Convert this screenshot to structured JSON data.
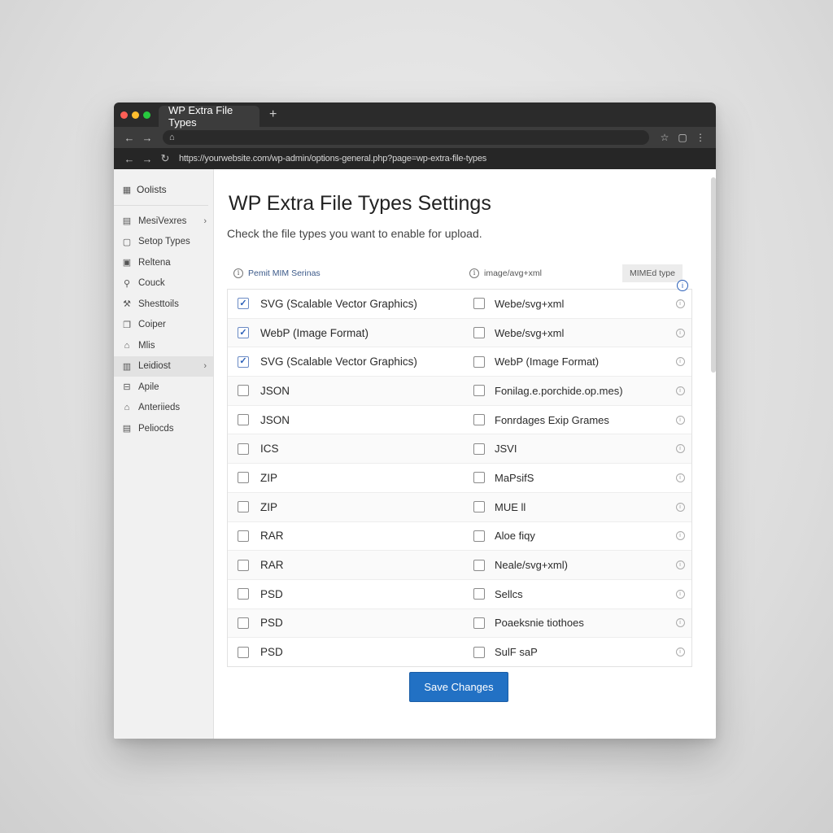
{
  "browser": {
    "tab_title": "WP Extra File Types",
    "new_tab_glyph": "+",
    "home_glyph": "⌂",
    "address": "https://yourwebsite.com/wp-admin/options-general.php?page=wp-extra-file-types"
  },
  "sidebar": {
    "header": "Oolists",
    "items": [
      {
        "label": "MesiVexres",
        "icon": "media-icon",
        "chevron": true,
        "active": false
      },
      {
        "label": "Setop Types",
        "icon": "page-icon",
        "chevron": false,
        "active": false
      },
      {
        "label": "Reltena",
        "icon": "grid-icon",
        "chevron": false,
        "active": false
      },
      {
        "label": "Couck",
        "icon": "plugin-icon",
        "chevron": false,
        "active": false
      },
      {
        "label": "Shesttoils",
        "icon": "tools-icon",
        "chevron": false,
        "active": false
      },
      {
        "label": "Coiper",
        "icon": "copy-icon",
        "chevron": false,
        "active": false
      },
      {
        "label": "Mlis",
        "icon": "house-icon",
        "chevron": false,
        "active": false
      },
      {
        "label": "Leidiost",
        "icon": "settings-icon",
        "chevron": true,
        "active": true
      },
      {
        "label": "Apile",
        "icon": "lock-icon",
        "chevron": false,
        "active": false
      },
      {
        "label": "Anteriieds",
        "icon": "building-icon",
        "chevron": false,
        "active": false
      },
      {
        "label": "Peliocds",
        "icon": "list-icon",
        "chevron": false,
        "active": false
      }
    ]
  },
  "page": {
    "title": "WP Extra File Types Settings",
    "subtitle": "Check the file types you want to enable for upload.",
    "columns": {
      "col1": "Pemit MIM Serinas",
      "col2": "image/avg+xml",
      "col3": "MIMEd type"
    },
    "rows": [
      {
        "checked": true,
        "label": "SVG (Scalable Vector Graphics)",
        "checked2": false,
        "label2": "Webe/svg+xml"
      },
      {
        "checked": true,
        "label": "WebP (Image Format)",
        "checked2": false,
        "label2": "Webe/svg+xml"
      },
      {
        "checked": true,
        "label": "SVG (Scalable Vector Graphics)",
        "checked2": false,
        "label2": "WebP (Image Format)"
      },
      {
        "checked": false,
        "label": "JSON",
        "checked2": false,
        "label2": "Fonilag.e.porchide.op.mes)"
      },
      {
        "checked": false,
        "label": "JSON",
        "checked2": false,
        "label2": "Fonrdages Exip Grames"
      },
      {
        "checked": false,
        "label": "ICS",
        "checked2": false,
        "label2": "JSVI"
      },
      {
        "checked": false,
        "label": "ZIP",
        "checked2": false,
        "label2": "MaPsifS"
      },
      {
        "checked": false,
        "label": "ZIP",
        "checked2": false,
        "label2": "MUE ll"
      },
      {
        "checked": false,
        "label": "RAR",
        "checked2": false,
        "label2": "Aloe fiqy"
      },
      {
        "checked": false,
        "label": "RAR",
        "checked2": false,
        "label2": "Neale/svg+xml)"
      },
      {
        "checked": false,
        "label": "PSD",
        "checked2": false,
        "label2": "Sellcs"
      },
      {
        "checked": false,
        "label": "PSD",
        "checked2": false,
        "label2": "Poaeksnie tiothoes"
      },
      {
        "checked": false,
        "label": "PSD",
        "checked2": false,
        "label2": "SulF saP"
      }
    ],
    "save_label": "Save Changes"
  },
  "colors": {
    "accent": "#2271c4",
    "chrome_dark": "#2b2b2b",
    "sidebar_bg": "#f1f1f1"
  }
}
